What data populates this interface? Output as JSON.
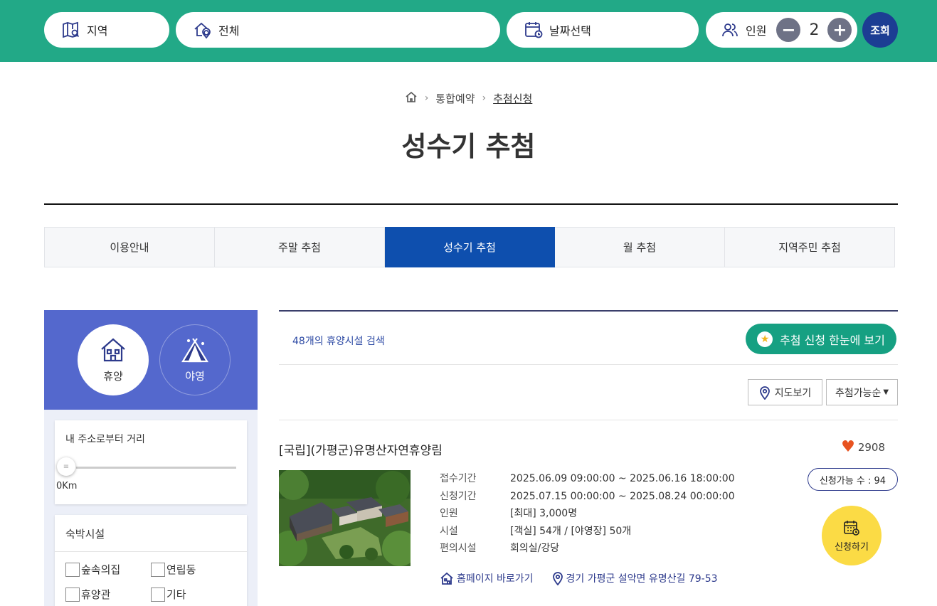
{
  "search": {
    "region_label": "지역",
    "area_label": "전체",
    "date_label": "날짜선택",
    "people_label": "인원",
    "people_count": "2",
    "minus": "−",
    "plus": "+",
    "search_label": "조회"
  },
  "breadcrumb": {
    "items": [
      "통합예약",
      "추첨신청"
    ]
  },
  "page_title": "성수기 추첨",
  "tabs": [
    {
      "label": "이용안내"
    },
    {
      "label": "주말 추첨"
    },
    {
      "label": "성수기 추첨",
      "active": true
    },
    {
      "label": "월 추첨"
    },
    {
      "label": "지역주민 추첨"
    }
  ],
  "sidebar": {
    "categories": [
      {
        "label": "휴양",
        "icon": "house-icon",
        "selected": true
      },
      {
        "label": "야영",
        "icon": "tent-icon",
        "selected": false
      }
    ],
    "distance": {
      "title": "내 주소로부터 거리",
      "value": "0Km",
      "slider_fraction": 0
    },
    "lodging": {
      "title": "숙박시설",
      "options": [
        "숲속의집",
        "연립동",
        "휴양관",
        "기타"
      ]
    }
  },
  "results": {
    "count_text": "48개의 휴양시설 검색",
    "all_button": "추첨 신청 한눈에 보기",
    "map_button": "지도보기",
    "sort_value": "추첨가능순",
    "items": [
      {
        "title": "[국립](가평군)유명산자연휴양림",
        "likes": "2908",
        "available": "신청가능 수 : 94",
        "apply": "신청하기",
        "info": [
          {
            "k": "접수기간",
            "v": "2025.06.09 09:00:00 ~ 2025.06.16 18:00:00"
          },
          {
            "k": "신청기간",
            "v": "2025.07.15 00:00:00 ~ 2025.08.24 00:00:00"
          },
          {
            "k": "인원",
            "v": "[최대] 3,000명"
          },
          {
            "k": "시설",
            "v": "[객실] 54개 / [야영장] 50개"
          },
          {
            "k": "편의시설",
            "v": "회의실/강당"
          }
        ],
        "homepage": "홈페이지 바로가기",
        "address": "경기 가평군 설악면 유명산길 79-53"
      }
    ]
  },
  "colors": {
    "topbar": "#22a987",
    "navy": "#1c3d93",
    "active_tab": "#0e4fae",
    "sidebar_head": "#5468cd",
    "apply": "#fbdb45"
  }
}
